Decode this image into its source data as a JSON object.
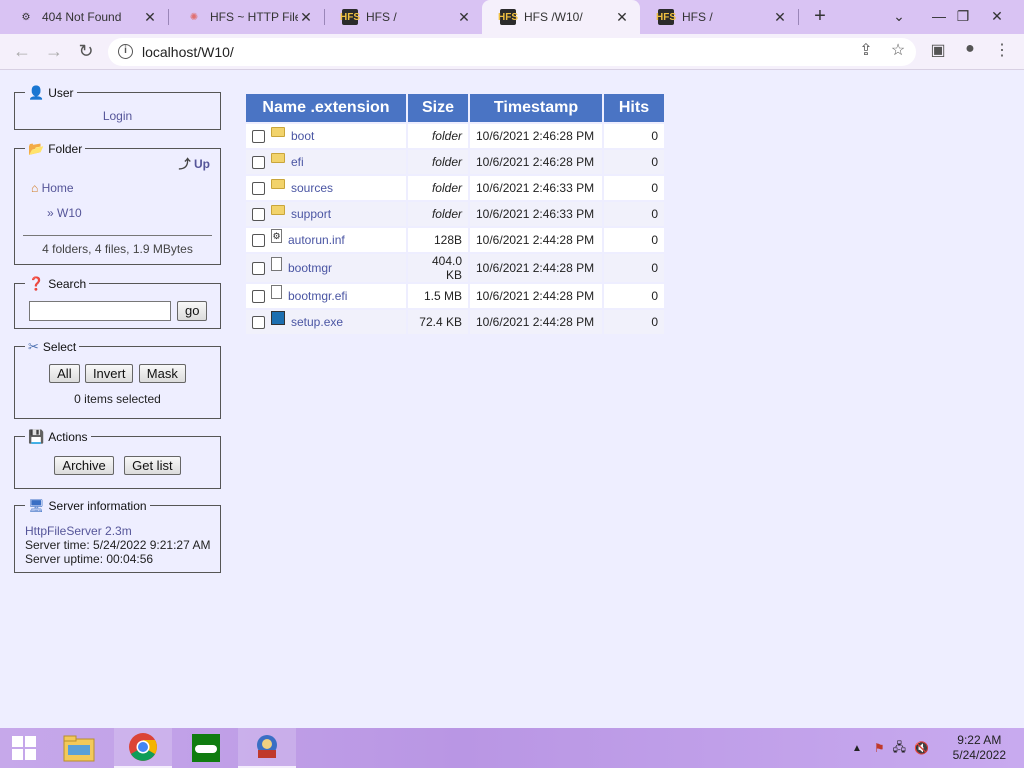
{
  "browser": {
    "tabs": [
      {
        "title": "404 Not Found",
        "icon": "server-icon"
      },
      {
        "title": "HFS ~ HTTP File S",
        "icon": "hfs-logo-icon"
      },
      {
        "title": "HFS /",
        "icon": "hfs-icon"
      },
      {
        "title": "HFS /W10/",
        "icon": "hfs-icon"
      },
      {
        "title": "HFS /",
        "icon": "hfs-icon"
      }
    ],
    "active_tab": 3,
    "url": "localhost/W10/"
  },
  "sidebar": {
    "user": {
      "title": "User",
      "login": "Login"
    },
    "folder": {
      "title": "Folder",
      "up": "Up",
      "home": "Home",
      "current": "» W10",
      "summary": "4 folders, 4 files, 1.9 MBytes"
    },
    "search": {
      "title": "Search",
      "placeholder": "",
      "go": "go"
    },
    "select": {
      "title": "Select",
      "all": "All",
      "invert": "Invert",
      "mask": "Mask",
      "selected": "0 items selected"
    },
    "actions": {
      "title": "Actions",
      "archive": "Archive",
      "get_list": "Get list"
    },
    "server": {
      "title": "Server information",
      "version": "HttpFileServer 2.3m",
      "time": "Server time: 5/24/2022 9:21:27 AM",
      "uptime": "Server uptime: 00:04:56"
    }
  },
  "table": {
    "headers": {
      "name": "Name .extension",
      "size": "Size",
      "timestamp": "Timestamp",
      "hits": "Hits"
    },
    "rows": [
      {
        "name": "boot",
        "type": "folder",
        "size": "folder",
        "timestamp": "10/6/2021 2:46:28 PM",
        "hits": "0"
      },
      {
        "name": "efi",
        "type": "folder",
        "size": "folder",
        "timestamp": "10/6/2021 2:46:28 PM",
        "hits": "0"
      },
      {
        "name": "sources",
        "type": "folder",
        "size": "folder",
        "timestamp": "10/6/2021 2:46:33 PM",
        "hits": "0"
      },
      {
        "name": "support",
        "type": "folder",
        "size": "folder",
        "timestamp": "10/6/2021 2:46:33 PM",
        "hits": "0"
      },
      {
        "name": "autorun.inf",
        "type": "settings-file",
        "size": "128B",
        "timestamp": "10/6/2021 2:44:28 PM",
        "hits": "0"
      },
      {
        "name": "bootmgr",
        "type": "file",
        "size": "404.0 KB",
        "timestamp": "10/6/2021 2:44:28 PM",
        "hits": "0"
      },
      {
        "name": "bootmgr.efi",
        "type": "file",
        "size": "1.5 MB",
        "timestamp": "10/6/2021 2:44:28 PM",
        "hits": "0"
      },
      {
        "name": "setup.exe",
        "type": "exe",
        "size": "72.4 KB",
        "timestamp": "10/6/2021 2:44:28 PM",
        "hits": "0"
      }
    ]
  },
  "taskbar": {
    "time": "9:22 AM",
    "date": "5/24/2022"
  }
}
